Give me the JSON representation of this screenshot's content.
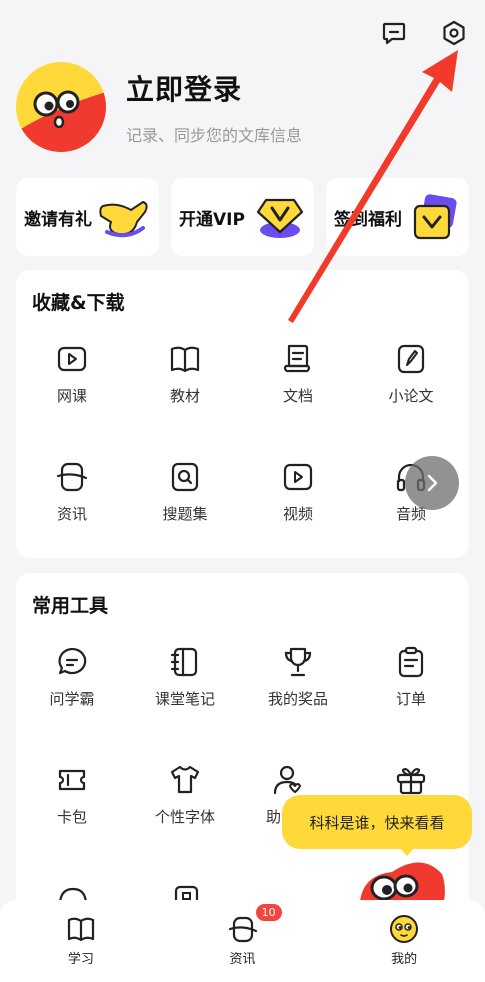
{
  "header": {
    "icons": [
      "message-icon",
      "settings-icon"
    ]
  },
  "profile": {
    "title": "立即登录",
    "subtitle": "记录、同步您的文库信息"
  },
  "quick_actions": [
    {
      "label": "邀请有礼",
      "icon": "waving-hand-icon"
    },
    {
      "label": "开通VIP",
      "icon": "vip-badge-icon"
    },
    {
      "label": "签到福利",
      "icon": "coupon-icon"
    }
  ],
  "favorites": {
    "title": "收藏&下载",
    "items": [
      {
        "label": "网课",
        "icon": "video-course-icon"
      },
      {
        "label": "教材",
        "icon": "book-icon"
      },
      {
        "label": "文档",
        "icon": "document-icon"
      },
      {
        "label": "小论文",
        "icon": "pen-note-icon"
      },
      {
        "label": "资讯",
        "icon": "news-icon"
      },
      {
        "label": "搜题集",
        "icon": "search-question-icon"
      },
      {
        "label": "视频",
        "icon": "video-icon"
      },
      {
        "label": "音频",
        "icon": "headphones-icon"
      }
    ]
  },
  "tools": {
    "title": "常用工具",
    "items": [
      {
        "label": "问学霸",
        "icon": "chat-bubble-icon"
      },
      {
        "label": "课堂笔记",
        "icon": "notebook-icon"
      },
      {
        "label": "我的奖品",
        "icon": "trophy-icon"
      },
      {
        "label": "订单",
        "icon": "clipboard-icon"
      },
      {
        "label": "卡包",
        "icon": "ticket-icon"
      },
      {
        "label": "个性字体",
        "icon": "tshirt-icon"
      },
      {
        "label": "助",
        "icon": "user-helper-icon"
      },
      {
        "label": "",
        "icon": "gift-icon"
      }
    ]
  },
  "promo": {
    "bubble_text": "科科是谁，快来看看"
  },
  "tabbar": {
    "items": [
      {
        "label": "学习",
        "icon": "study-book-icon"
      },
      {
        "label": "资讯",
        "icon": "news-tab-icon",
        "badge": "10"
      },
      {
        "label": "我的",
        "icon": "profile-face-icon"
      }
    ]
  },
  "colors": {
    "brand_yellow": "#ffd83a",
    "accent_red": "#f03a2f",
    "annotation_arrow": "#f23a2a",
    "badge_red": "#f2453d"
  }
}
